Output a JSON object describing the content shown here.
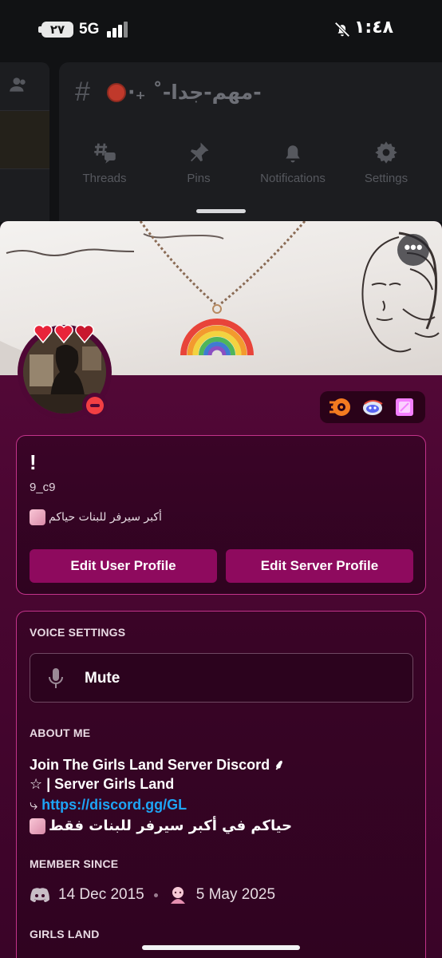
{
  "status_bar": {
    "battery": "٢٧",
    "network": "5G",
    "time": "١:٤٨"
  },
  "channel": {
    "name": "-مهم-جدا-˚ ₊·",
    "tabs": [
      {
        "label": "Threads",
        "icon": "threads-icon"
      },
      {
        "label": "Pins",
        "icon": "pin-icon"
      },
      {
        "label": "Notifications",
        "icon": "bell-icon"
      },
      {
        "label": "Settings",
        "icon": "gear-icon"
      }
    ]
  },
  "profile": {
    "display_name": "!",
    "username": "9_c9",
    "pronouns": "أكبر سيرفر للبنات حياكم",
    "buttons": {
      "edit_user": "Edit User Profile",
      "edit_server": "Edit Server Profile"
    }
  },
  "voice_settings": {
    "title": "VOICE SETTINGS",
    "mute_label": "Mute"
  },
  "about_me": {
    "title": "ABOUT ME",
    "line1": "Join The Girls Land Server Discord ⸙",
    "line2": "☆ | Server Girls Land",
    "line3_prefix": "⤷",
    "line3_link": "https://discord.gg/GL",
    "line4": "حياكم في أكبر سيرفر للبنات فقط"
  },
  "member_since": {
    "title": "MEMBER SINCE",
    "discord_date": "14 Dec 2015",
    "server_date": "5 May 2025"
  },
  "girls_land": {
    "title": "GIRLS LAND"
  },
  "colors": {
    "accent": "#8e0a5e",
    "border": "#c2338a",
    "link": "#1ea4f4",
    "dnd": "#f23f43"
  }
}
